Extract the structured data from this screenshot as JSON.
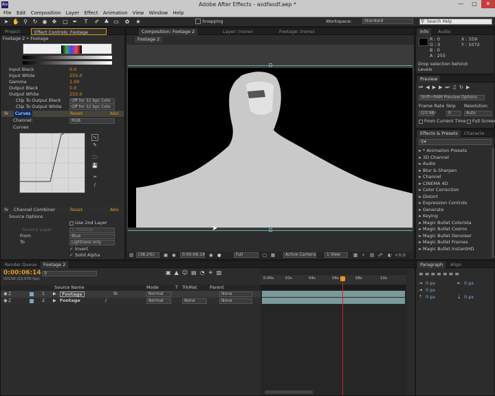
{
  "window": {
    "title": "Adobe After Effects - asdfasdf.aep *",
    "logo": "Ae"
  },
  "menu": [
    "File",
    "Edit",
    "Composition",
    "Layer",
    "Effect",
    "Animation",
    "View",
    "Window",
    "Help"
  ],
  "toolbar": {
    "snapping": "Snapping",
    "workspace_label": "Workspace:",
    "workspace_value": "Standard",
    "search_placeholder": "Search Help"
  },
  "left_panel": {
    "tabs": [
      "Project",
      "Effect Controls: Footage"
    ],
    "layer_path": "Footage 2 • Footage",
    "levels": [
      {
        "label": "Input Black",
        "value": "0.0"
      },
      {
        "label": "Input White",
        "value": "255.0"
      },
      {
        "label": "Gamma",
        "value": "1.00"
      },
      {
        "label": "Output Black",
        "value": "0.0"
      },
      {
        "label": "Output White",
        "value": "255.0"
      }
    ],
    "clip_black": {
      "label": "Clip To Output Black",
      "value": "Off for 32 bpc Colo"
    },
    "clip_white": {
      "label": "Clip To Output White",
      "value": "Off for 32 bpc Colo"
    },
    "curves": {
      "name": "Curves",
      "reset": "Reset",
      "about": "Abo",
      "channel_label": "Channel:",
      "channel_value": "RGB",
      "curves_label": "Curves"
    },
    "combiner": {
      "name": "Channel Combiner",
      "reset": "Reset",
      "about": "Abo",
      "source_options": "Source Options",
      "use_2nd_layer": "Use 2nd Layer",
      "source_layer": "Source Layer",
      "source_layer_value": "1. Footage",
      "from_label": "From",
      "from_value": "Blue",
      "to_label": "To",
      "to_value": "Lightness only",
      "invert": "Invert",
      "solid_alpha": "Solid Alpha"
    }
  },
  "comp_panel": {
    "tabs": [
      "Composition: Footage 2",
      "Layer: (none)",
      "Footage: (none)"
    ],
    "subtab": "Footage 2",
    "zoom": "(38.2%)",
    "timecode": "0:00:06:14",
    "resolution": "Full",
    "camera": "Active Camera",
    "view": "1 View",
    "exposure": "+0.0"
  },
  "info": {
    "tabs": [
      "Info",
      "Audio"
    ],
    "r": "R : 0",
    "g": "G : 0",
    "b": "B : 0",
    "a": "A : 255",
    "x": "X : 559",
    "y": "Y : 1072",
    "drop_line1": "Drop selection behind:",
    "drop_line2": "Levels"
  },
  "preview": {
    "tab": "Preview",
    "options": "Shift+RAM Preview Options",
    "frame_rate_label": "Frame Rate",
    "skip_label": "Skip",
    "resolution_label": "Resolution",
    "frame_rate": "(23.98)",
    "skip": "0",
    "resolution": "Auto",
    "from_current": "From Current Time",
    "full_screen": "Full Screen"
  },
  "effects": {
    "tabs": [
      "Effects & Presets",
      "Characte"
    ],
    "items": [
      "* Animation Presets",
      "3D Channel",
      "Audio",
      "Blur & Sharpen",
      "Channel",
      "CINEMA 4D",
      "Color Correction",
      "Distort",
      "Expression Controls",
      "Generate",
      "Keying",
      "Magic Bullet Colorista",
      "Magic Bullet Cosmo",
      "Magic Bullet Denoiser",
      "Magic Bullet Frames",
      "Magic Bullet InstantHD"
    ]
  },
  "paragraph": {
    "tabs": [
      "Paragraph",
      "Align"
    ],
    "values": [
      "0 px",
      "0 px",
      "0 px",
      "0 px",
      "0 px"
    ]
  },
  "timeline": {
    "tabs": [
      "Render Queue",
      "Footage 2"
    ],
    "timecode": "0:00:06:14",
    "frames": "00158 (23.976 fps)",
    "columns": {
      "source_name": "Source Name",
      "mode": "Mode",
      "t": "T",
      "trkmat": "TrkMat",
      "parent": "Parent"
    },
    "layers": [
      {
        "num": "1",
        "name": "Footage",
        "mode": "Normal",
        "trkmat": "",
        "parent": "None"
      },
      {
        "num": "2",
        "name": "Footage",
        "mode": "Normal",
        "trkmat": "None",
        "parent": "None"
      }
    ],
    "ruler": [
      "0:00s",
      "02s",
      "04s",
      "06s",
      "08s",
      "10s"
    ],
    "playhead_fraction": 0.56
  },
  "colors": {
    "accent": "#e09a1e",
    "link": "#7fb0e0",
    "playhead": "#d02020",
    "layer_bar": "#7a9a9a"
  }
}
